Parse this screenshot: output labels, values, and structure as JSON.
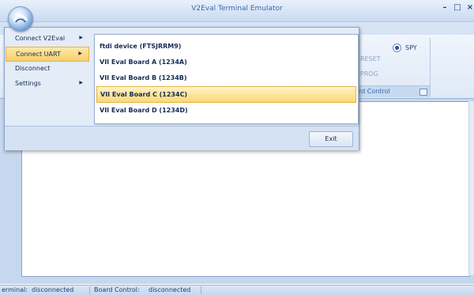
{
  "window": {
    "title": "V2Eval Terminal Emulator",
    "controls": [
      "–",
      "□",
      "×"
    ]
  },
  "ribbon": {
    "spy_label": "SPY",
    "spy_selected": true,
    "reset_label": "RESET",
    "prog_label": "PROG",
    "group_label": "rd Control"
  },
  "app_menu": {
    "items": [
      {
        "label": "Connect V2Eval",
        "has_submenu": true,
        "highlighted": false
      },
      {
        "label": "Connect UART",
        "has_submenu": true,
        "highlighted": true
      },
      {
        "label": "Disconnect",
        "has_submenu": false,
        "highlighted": false
      },
      {
        "label": "Settings",
        "has_submenu": true,
        "highlighted": false
      }
    ],
    "submenu": [
      {
        "label": "ftdi device (FTSJRRM9)",
        "highlighted": false
      },
      {
        "label": "VII Eval Board A (1234A)",
        "highlighted": false
      },
      {
        "label": "VII Eval Board B (1234B)",
        "highlighted": false
      },
      {
        "label": "VII Eval Board C (1234C)",
        "highlighted": true
      },
      {
        "label": "VII Eval Board D (1234D)",
        "highlighted": false
      }
    ],
    "exit_label": "Exit"
  },
  "status": {
    "terminal_label": "erminal:",
    "terminal_value": "disconnected",
    "board_label": "Board Control:",
    "board_value": "disconnected"
  },
  "colors": {
    "menu_highlight": "#f8cf6d",
    "frame_blue": "#c6d7ee",
    "text_blue": "#15428b"
  }
}
